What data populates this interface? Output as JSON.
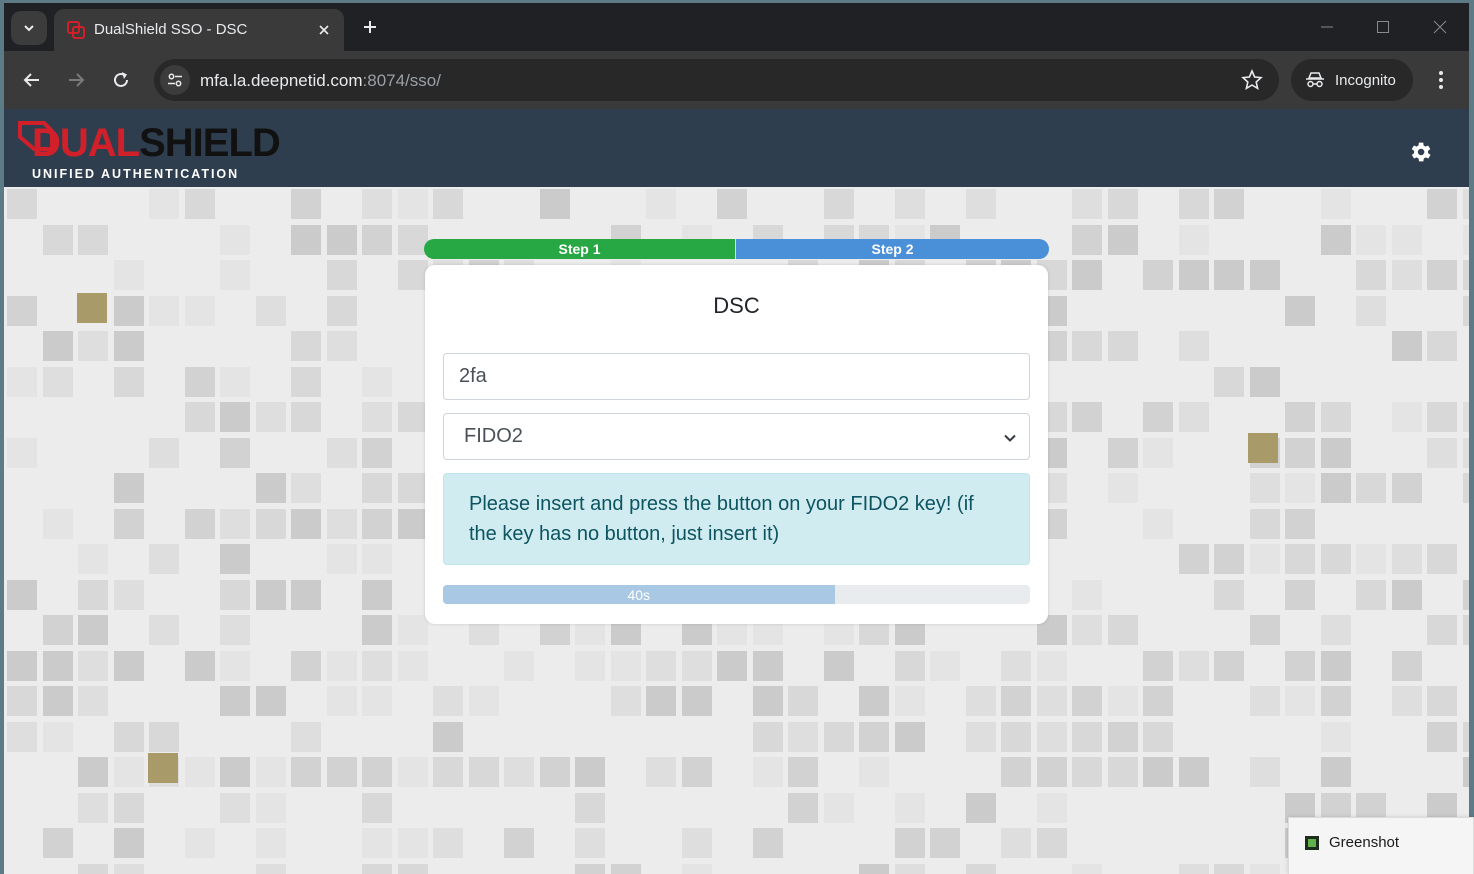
{
  "browser": {
    "tab_title": "DualShield SSO - DSC",
    "url_host": "mfa.la.deepnetid.com",
    "url_path": ":8074/sso/",
    "profile_label": "Incognito"
  },
  "app": {
    "logo_dual": "DUAL",
    "logo_shield": "SHIELD",
    "logo_tagline": "UNIFIED AUTHENTICATION"
  },
  "steps": [
    "Step 1",
    "Step 2"
  ],
  "card": {
    "title": "DSC",
    "username_value": "2fa",
    "method_selected": "FIDO2",
    "alert_text": "Please insert and press the button on your FIDO2 key! (if the key has no button, just insert it)",
    "timer_label": "40s",
    "timer_fraction": 0.667
  },
  "toast": {
    "title": "Greenshot"
  },
  "colors": {
    "header_bg": "#2f3e4e",
    "brand_red": "#d2202a",
    "step_done": "#28a745",
    "step_next": "#4a90d9",
    "alert_bg": "#d1ecf1",
    "alert_text": "#0c5460"
  },
  "icons": {
    "tab_search": "chevron-down-icon",
    "favicon": "dualshield-icon",
    "close": "close-icon",
    "new_tab": "plus-icon",
    "back": "arrow-left-icon",
    "forward": "arrow-right-icon",
    "reload": "reload-icon",
    "site_info": "tune-icon",
    "bookmark": "star-icon",
    "incognito": "incognito-icon",
    "menu": "kebab-icon",
    "settings": "gear-icon"
  }
}
